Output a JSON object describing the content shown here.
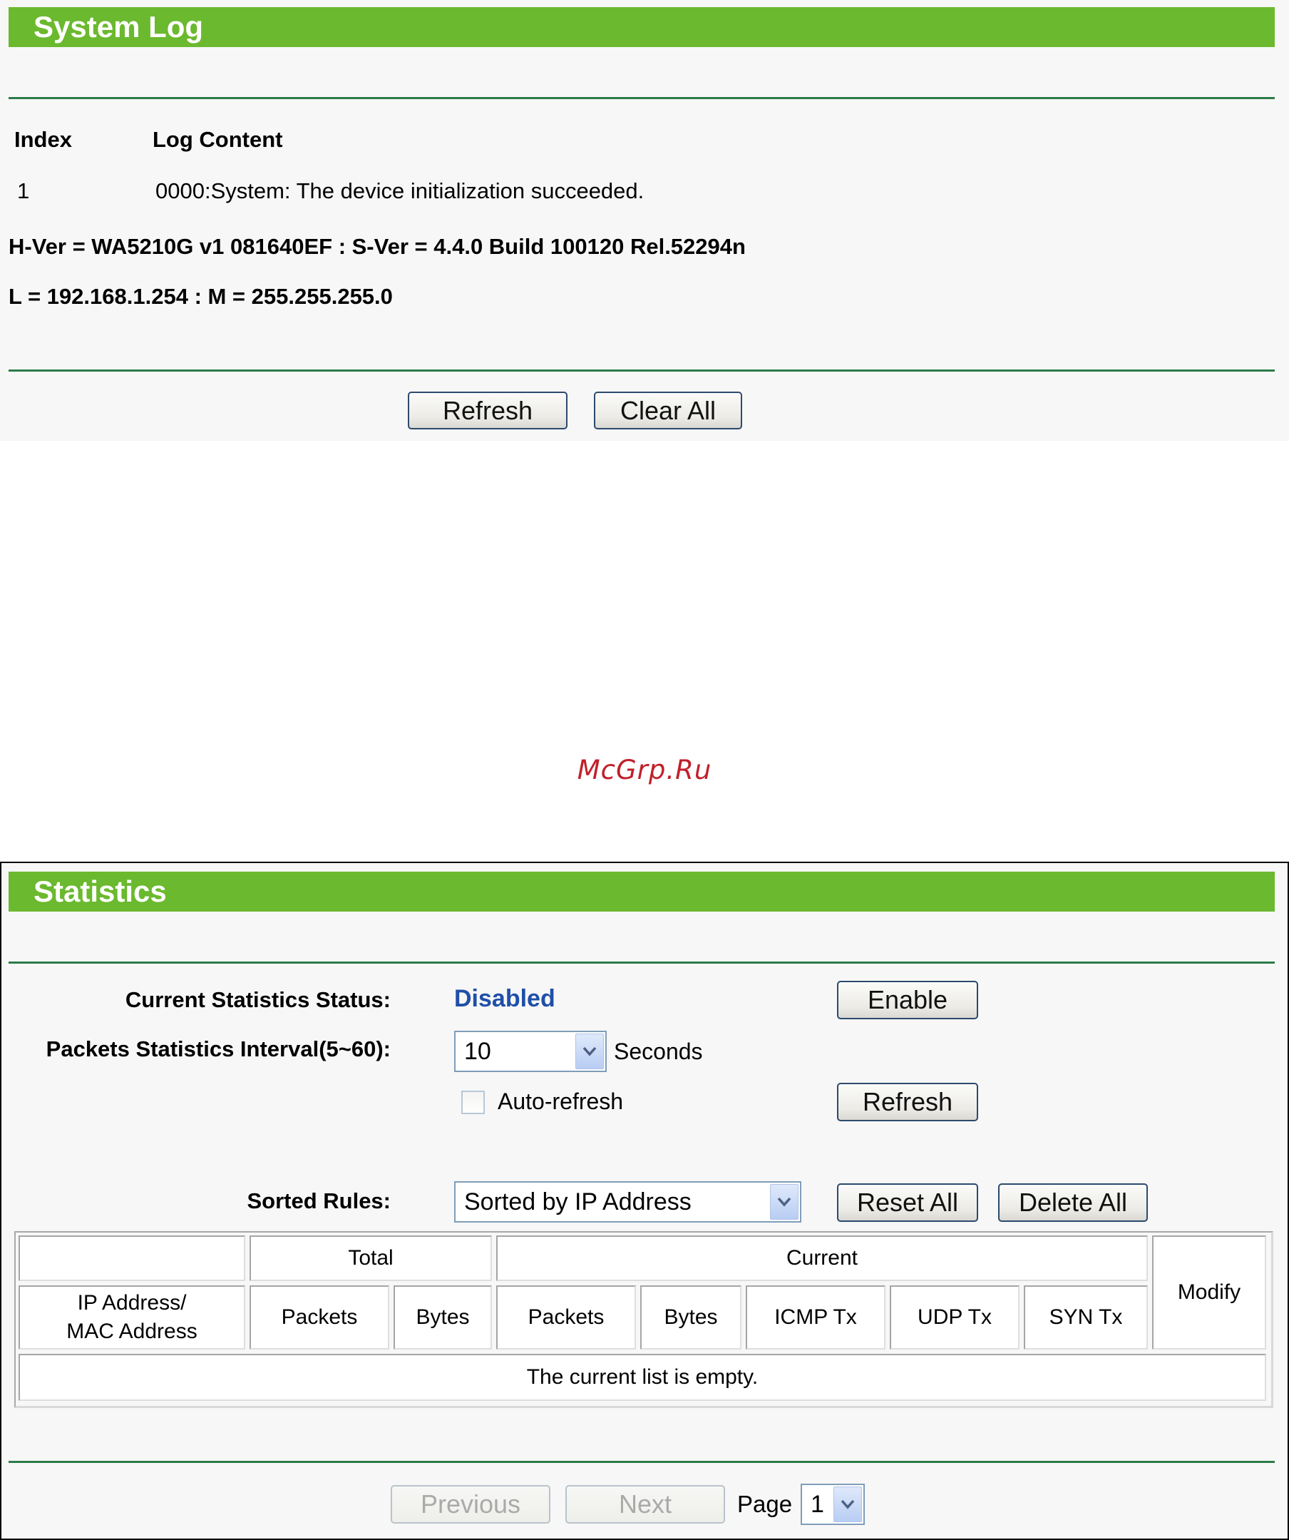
{
  "system_log": {
    "title": "System Log",
    "col_index": "Index",
    "col_content": "Log Content",
    "entries": [
      {
        "index": "1",
        "content": "0000:System: The device initialization succeeded."
      }
    ],
    "version_line": "H-Ver = WA5210G v1 081640EF : S-Ver = 4.4.0 Build 100120 Rel.52294n",
    "address_line": "L = 192.168.1.254 : M = 255.255.255.0",
    "refresh_label": "Refresh",
    "clear_all_label": "Clear All"
  },
  "watermark": "McGrp.Ru",
  "statistics": {
    "title": "Statistics",
    "status_label": "Current Statistics Status:",
    "status_value": "Disabled",
    "enable_label": "Enable",
    "interval_label": "Packets Statistics Interval(5~60):",
    "interval_value": "10",
    "interval_unit": "Seconds",
    "autorefresh_label": "Auto-refresh",
    "autorefresh_checked": false,
    "refresh_label": "Refresh",
    "sorted_rules_label": "Sorted Rules:",
    "sorted_rules_value": "Sorted by IP Address",
    "reset_all_label": "Reset All",
    "delete_all_label": "Delete All",
    "table": {
      "group_total": "Total",
      "group_current": "Current",
      "modify": "Modify",
      "ip_line1": "IP Address/",
      "ip_line2": "MAC Address",
      "total_packets": "Packets",
      "total_bytes": "Bytes",
      "current_packets": "Packets",
      "current_bytes": "Bytes",
      "icmp_tx": "ICMP Tx",
      "udp_tx": "UDP Tx",
      "syn_tx": "SYN Tx",
      "empty_message": "The current list is empty."
    },
    "previous_label": "Previous",
    "next_label": "Next",
    "page_label": "Page",
    "page_value": "1"
  },
  "colors": {
    "header_green": "#6bb92e",
    "rule_green": "#2c7b49",
    "status_blue": "#1f4fa8",
    "watermark_red": "#c0202a"
  }
}
